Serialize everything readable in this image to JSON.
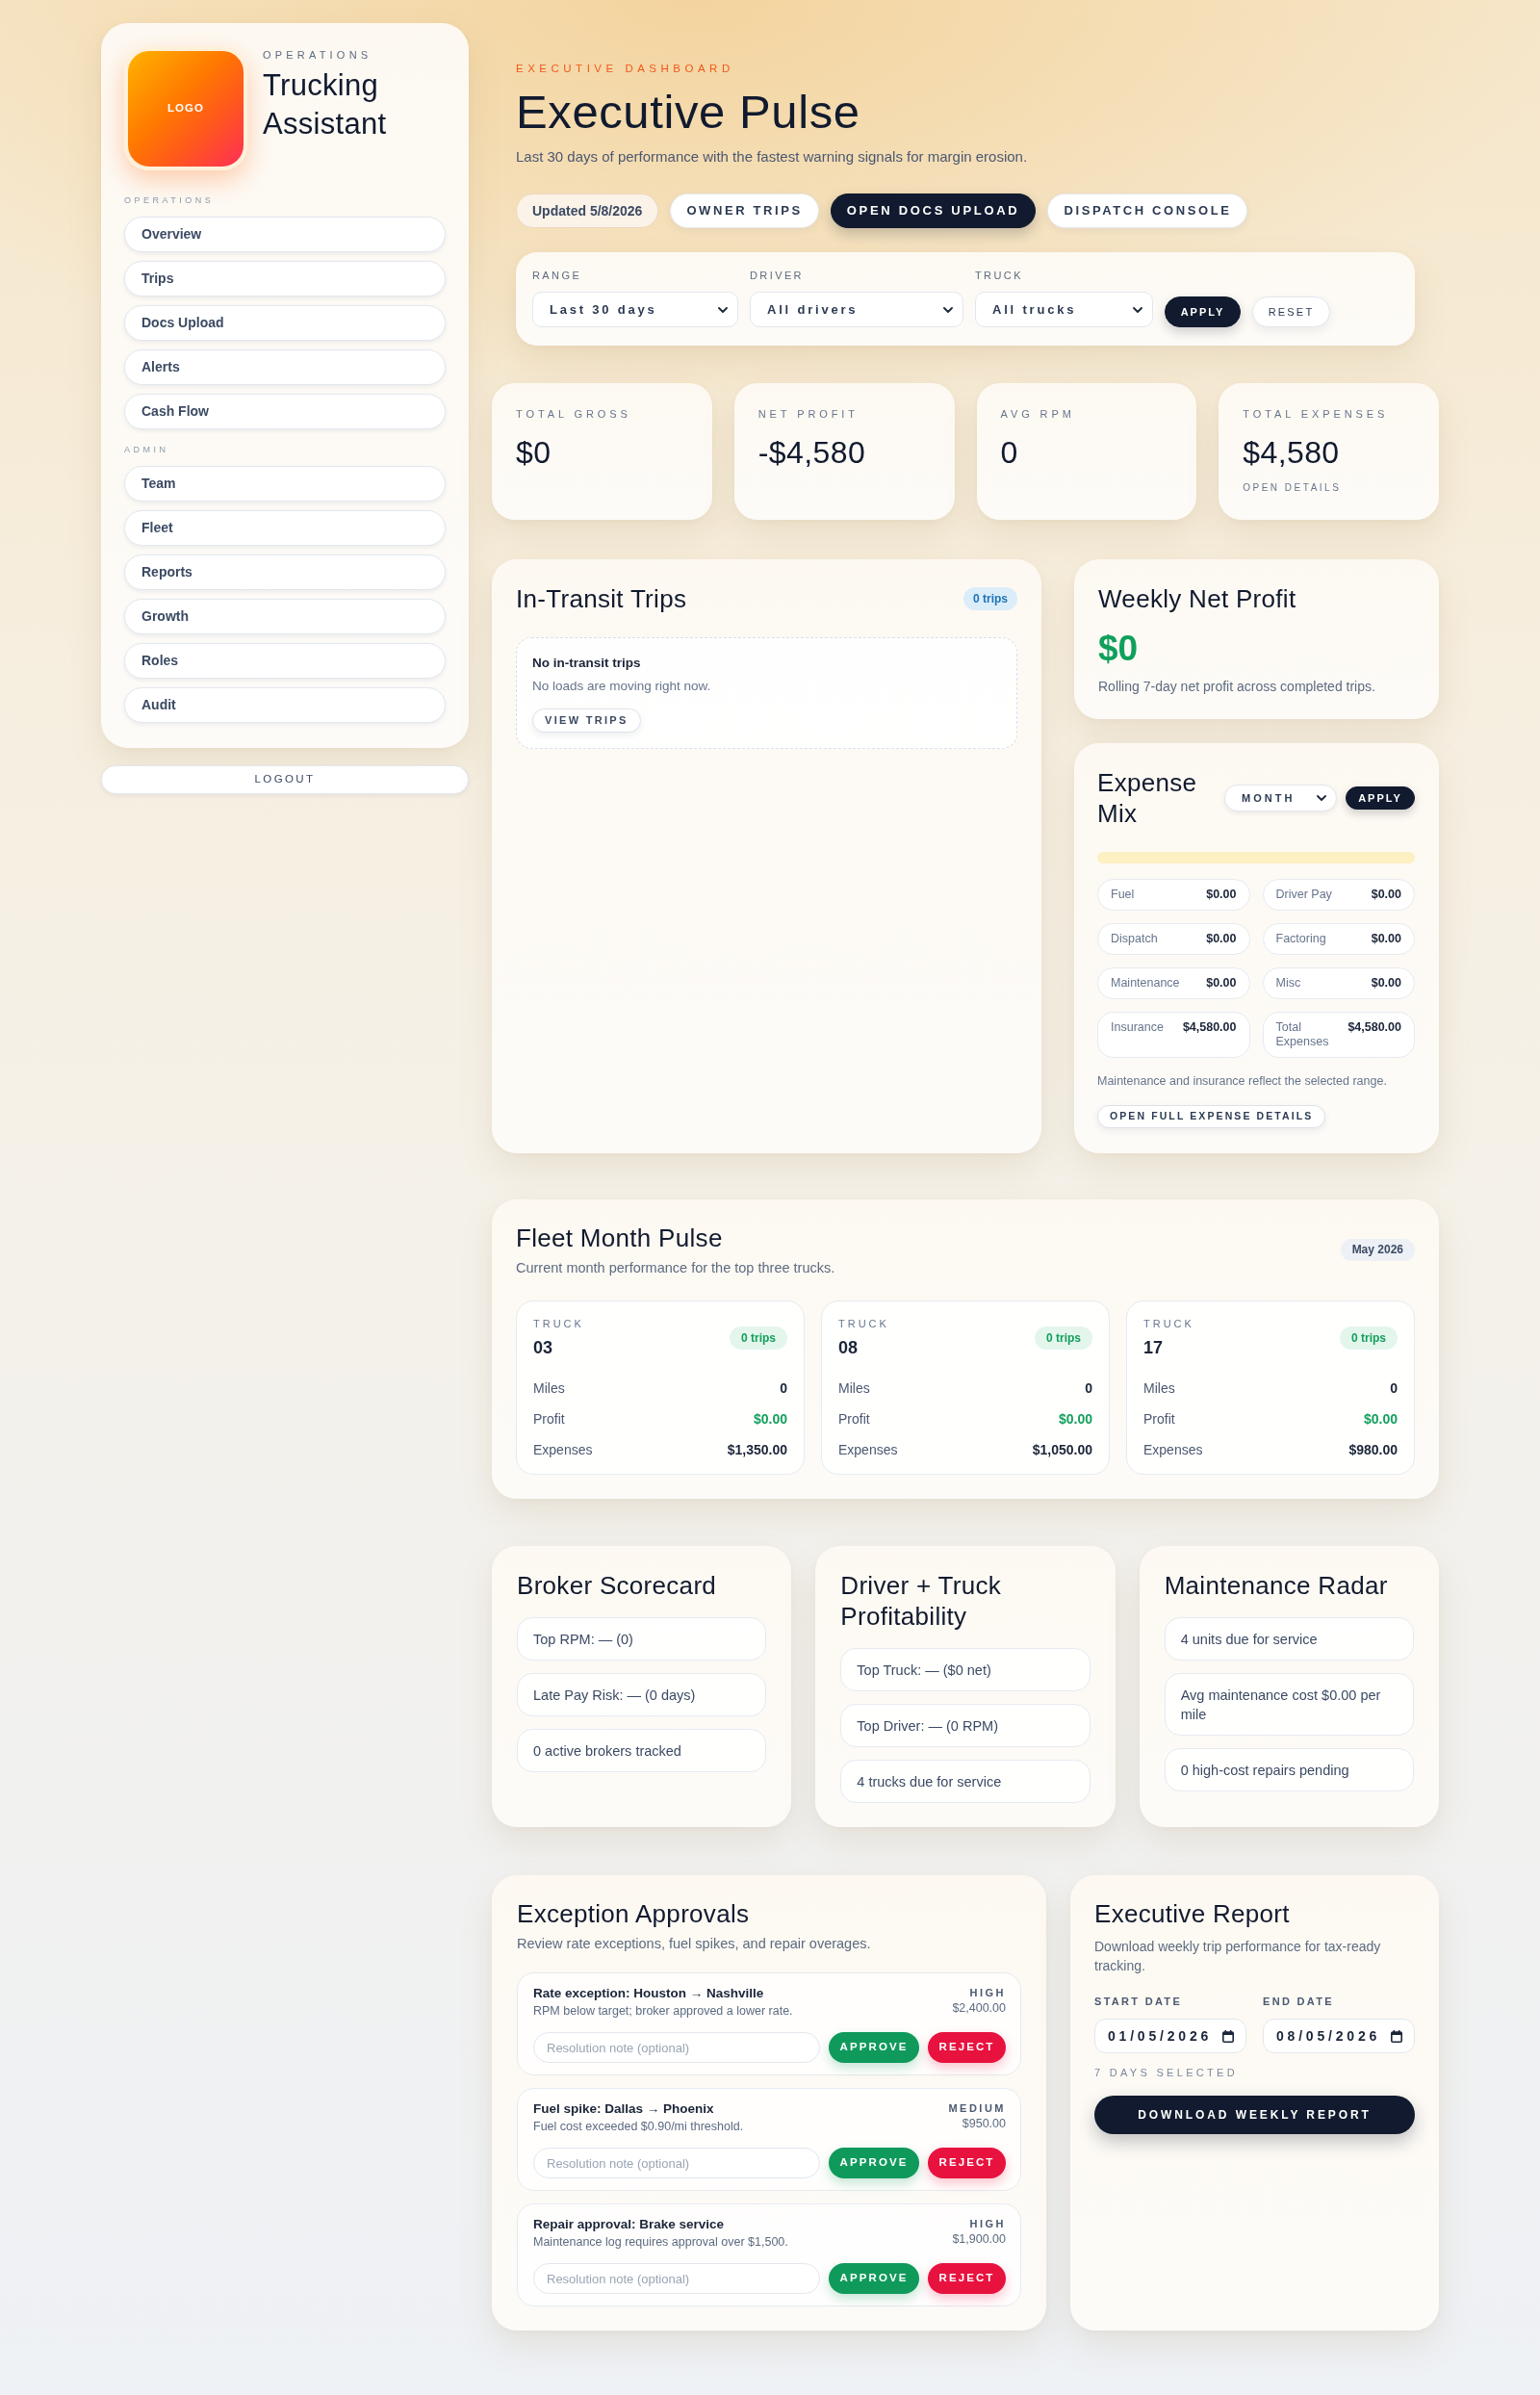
{
  "sidebar": {
    "logo": "LOGO",
    "eyebrow": "OPERATIONS",
    "brand": "Trucking Assistant",
    "sections": [
      {
        "label": "OPERATIONS",
        "items": [
          {
            "label": "Overview",
            "selected": false
          },
          {
            "label": "Trips",
            "selected": false
          },
          {
            "label": "Docs Upload",
            "selected": false
          },
          {
            "label": "Alerts",
            "selected": false
          },
          {
            "label": "Cash Flow",
            "selected": false
          }
        ]
      },
      {
        "label": "ADMIN",
        "items": [
          {
            "label": "Team",
            "selected": false
          },
          {
            "label": "Fleet",
            "selected": false
          },
          {
            "label": "Reports",
            "selected": false
          },
          {
            "label": "Growth",
            "selected": false
          },
          {
            "label": "Roles",
            "selected": false
          },
          {
            "label": "Audit",
            "selected": false
          }
        ]
      }
    ],
    "logout": "LOGOUT"
  },
  "header": {
    "eyebrow": "EXECUTIVE DASHBOARD",
    "title": "Executive Pulse",
    "subtitle": "Last 30 days of performance with the fastest warning signals for margin erosion.",
    "actions": [
      {
        "kind": "chip",
        "label": "Updated 5/8/2026"
      },
      {
        "kind": "outline",
        "label": "OWNER TRIPS"
      },
      {
        "kind": "dark",
        "label": "OPEN DOCS UPLOAD"
      },
      {
        "kind": "outline",
        "label": "DISPATCH CONSOLE"
      }
    ]
  },
  "filters": {
    "fields": [
      {
        "label": "RANGE",
        "value": "Last 30 days"
      },
      {
        "label": "DRIVER",
        "value": "All drivers"
      },
      {
        "label": "TRUCK",
        "value": "All trucks"
      }
    ],
    "apply": "APPLY",
    "reset": "RESET"
  },
  "kpis": [
    {
      "label": "TOTAL GROSS",
      "value": "$0"
    },
    {
      "label": "NET PROFIT",
      "value": "-$4,580"
    },
    {
      "label": "AVG RPM",
      "value": "0"
    },
    {
      "label": "TOTAL EXPENSES",
      "value": "$4,580",
      "link": "OPEN DETAILS"
    }
  ],
  "in_transit": {
    "title": "In-Transit Trips",
    "badge": "0 trips",
    "empty": {
      "title": "No in-transit trips",
      "text": "No loads are moving right now.",
      "button": "VIEW TRIPS"
    }
  },
  "weekly_net_profit": {
    "title": "Weekly Net Profit",
    "value": "$0",
    "note": "Rolling 7-day net profit across completed trips."
  },
  "expense_mix": {
    "title": "Expense Mix",
    "period": "MONTH",
    "apply": "APPLY",
    "items": [
      {
        "label": "Fuel",
        "value": "$0.00"
      },
      {
        "label": "Driver Pay",
        "value": "$0.00"
      },
      {
        "label": "Dispatch",
        "value": "$0.00"
      },
      {
        "label": "Factoring",
        "value": "$0.00"
      },
      {
        "label": "Maintenance",
        "value": "$0.00"
      },
      {
        "label": "Misc",
        "value": "$0.00"
      },
      {
        "label": "Insurance",
        "value": "$4,580.00"
      },
      {
        "label": "Total Expenses",
        "value": "$4,580.00"
      }
    ],
    "note": "Maintenance and insurance reflect the selected range.",
    "button": "OPEN FULL EXPENSE DETAILS"
  },
  "fleet_month_pulse": {
    "title": "Fleet Month Pulse",
    "subtitle": "Current month performance for the top three trucks.",
    "badge": "May 2026",
    "trucks": [
      {
        "label": "TRUCK",
        "number": "03",
        "badge": "0 trips",
        "stats": [
          {
            "label": "Miles",
            "value": "0",
            "kind": "plain"
          },
          {
            "label": "Profit",
            "value": "$0.00",
            "kind": "positive"
          },
          {
            "label": "Expenses",
            "value": "$1,350.00",
            "kind": "plain"
          }
        ]
      },
      {
        "label": "TRUCK",
        "number": "08",
        "badge": "0 trips",
        "stats": [
          {
            "label": "Miles",
            "value": "0",
            "kind": "plain"
          },
          {
            "label": "Profit",
            "value": "$0.00",
            "kind": "positive"
          },
          {
            "label": "Expenses",
            "value": "$1,050.00",
            "kind": "plain"
          }
        ]
      },
      {
        "label": "TRUCK",
        "number": "17",
        "badge": "0 trips",
        "stats": [
          {
            "label": "Miles",
            "value": "0",
            "kind": "plain"
          },
          {
            "label": "Profit",
            "value": "$0.00",
            "kind": "positive"
          },
          {
            "label": "Expenses",
            "value": "$980.00",
            "kind": "plain"
          }
        ]
      }
    ]
  },
  "insights": [
    {
      "title": "Broker Scorecard",
      "items": [
        "Top RPM: — (0)",
        "Late Pay Risk: — (0 days)",
        "0 active brokers tracked"
      ]
    },
    {
      "title": "Driver + Truck Profitability",
      "items": [
        "Top Truck: — ($0 net)",
        "Top Driver: — (0 RPM)",
        "4 trucks due for service"
      ]
    },
    {
      "title": "Maintenance Radar",
      "items": [
        "4 units due for service",
        "Avg maintenance cost $0.00 per mile",
        "0 high-cost repairs pending"
      ]
    }
  ],
  "exception_approvals": {
    "title": "Exception Approvals",
    "subtitle": "Review rate exceptions, fuel spikes, and repair overages.",
    "items": [
      {
        "title": "Rate exception: Houston → Nashville",
        "detail": "RPM below target; broker approved a lower rate.",
        "priority": "HIGH",
        "amount": "$2,400.00",
        "placeholder": "Resolution note (optional)",
        "approve": "APPROVE",
        "reject": "REJECT"
      },
      {
        "title": "Fuel spike: Dallas → Phoenix",
        "detail": "Fuel cost exceeded $0.90/mi threshold.",
        "priority": "MEDIUM",
        "amount": "$950.00",
        "placeholder": "Resolution note (optional)",
        "approve": "APPROVE",
        "reject": "REJECT"
      },
      {
        "title": "Repair approval: Brake service",
        "detail": "Maintenance log requires approval over $1,500.",
        "priority": "HIGH",
        "amount": "$1,900.00",
        "placeholder": "Resolution note (optional)",
        "approve": "APPROVE",
        "reject": "REJECT"
      }
    ]
  },
  "executive_report": {
    "title": "Executive Report",
    "description": "Download weekly trip performance for tax-ready tracking.",
    "start": {
      "label": "START DATE",
      "value": "01/05/2026"
    },
    "end": {
      "label": "END DATE",
      "value": "08/05/2026"
    },
    "days": "7 DAYS SELECTED",
    "button": "DOWNLOAD WEEKLY REPORT"
  }
}
